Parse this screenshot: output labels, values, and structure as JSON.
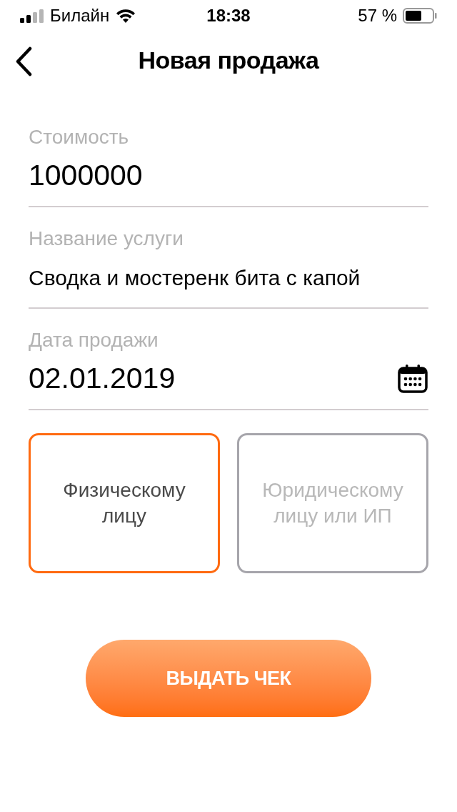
{
  "status_bar": {
    "carrier": "Билайн",
    "time": "18:38",
    "battery": "57 %"
  },
  "header": {
    "title": "Новая продажа"
  },
  "fields": [
    {
      "kind": "text",
      "label": "Стоимость",
      "value": "1000000",
      "large": true
    },
    {
      "kind": "text",
      "label": "Название услуги",
      "value": "Сводка и мостеренк бита с капой",
      "large": false
    },
    {
      "kind": "date",
      "label": "Дата продажи",
      "value": "02.01.2019",
      "large": true
    }
  ],
  "client_types": [
    {
      "label": "Физическому лицу",
      "selected": true
    },
    {
      "label": "Юридическому лицу или ИП",
      "selected": false
    }
  ],
  "submit_button": {
    "label": "ВЫДАТЬ ЧЕК"
  }
}
